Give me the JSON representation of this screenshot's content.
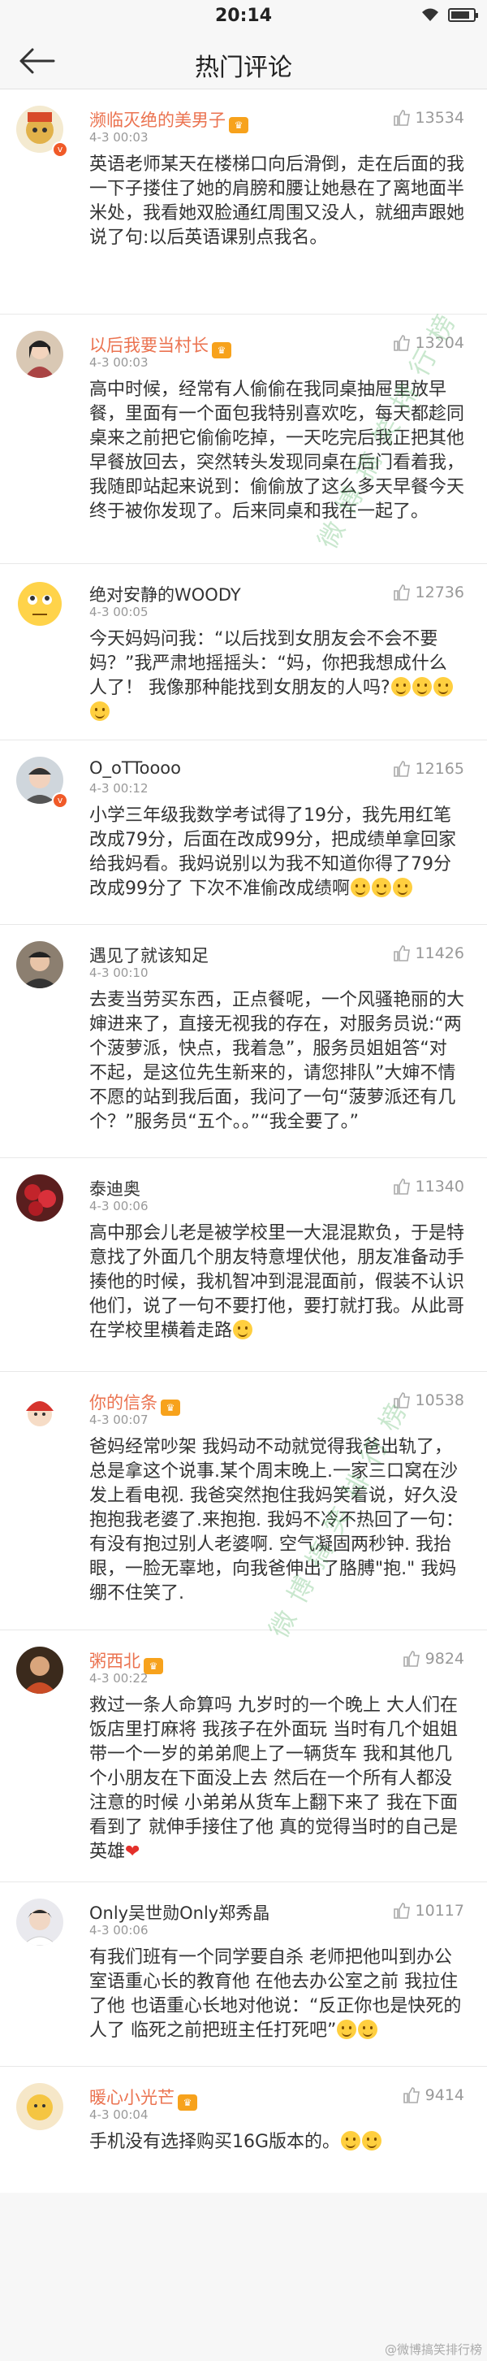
{
  "status": {
    "time": "20:14"
  },
  "header": {
    "title": "热门评论"
  },
  "watermark": "微博搞笑排行榜",
  "footer_watermark": "@微博搞笑排行榜",
  "comments": [
    {
      "name": "濒临灭绝的美男子",
      "vip": true,
      "date": "4-3 00:03",
      "likes": "13534",
      "text": "英语老师某天在楼梯口向后滑倒，走在后面的我一下子搂住了她的肩膀和腰让她悬在了离地面半米处，我看她双脸通红周围又没人，就细声跟她说了句:以后英语课别点我名。"
    },
    {
      "name": "以后我要当村长",
      "vip": true,
      "date": "4-3 00:03",
      "likes": "13204",
      "text": "高中时候，经常有人偷偷在我同桌抽屉里放早餐，里面有一个面包我特别喜欢吃，每天都趁同桌来之前把它偷偷吃掉，一天吃完后我正把其他早餐放回去，突然转头发现同桌在后门看着我，我随即站起来说到：偷偷放了这么多天早餐今天终于被你发现了。后来同桌和我在一起了。"
    },
    {
      "name": "绝对安静的WOODY",
      "vip": false,
      "date": "4-3 00:05",
      "likes": "12736",
      "text": "今天妈妈问我：“以后找到女朋友会不会不要妈？”我严肃地摇摇头：“妈，你把我想成什么人了！                    我像那种能找到女朋友的人吗?"
    },
    {
      "name": "O_oTToooo",
      "vip": false,
      "date": "4-3 00:12",
      "likes": "12165",
      "text": "小学三年级我数学考试得了19分，我先用红笔改成79分，后面在改成99分，把成绩单拿回家给我妈看。我妈说别以为我不知道你得了79分改成99分了 下次不准偷改成绩啊"
    },
    {
      "name": "遇见了就该知足",
      "vip": false,
      "date": "4-3 00:10",
      "likes": "11426",
      "text": "去麦当劳买东西，正点餐呢，一个风骚艳丽的大婶进来了，直接无视我的存在，对服务员说:“两个菠萝派，快点，我着急”，服务员姐姐答“对不起，是这位先生新来的，请您排队”大婶不情不愿的站到我后面，我问了一句“菠萝派还有几个？”服务员“五个。。”“我全要了。”"
    },
    {
      "name": "泰迪奥",
      "vip": false,
      "date": "4-3 00:06",
      "likes": "11340",
      "text": "高中那会儿老是被学校里一大混混欺负，于是特意找了外面几个朋友特意埋伏他，朋友准备动手揍他的时候，我机智冲到混混面前，假装不认识他们，说了一句不要打他，要打就打我。从此哥在学校里横着走路"
    },
    {
      "name": "你的信条",
      "vip": true,
      "date": "4-3 00:07",
      "likes": "10538",
      "text": "爸妈经常吵架 我妈动不动就觉得我爸出轨了，总是拿这个说事.某个周末晚上.一家三口窝在沙发上看电视. 我爸突然抱住我妈笑着说，好久没抱抱我老婆了.来抱抱. 我妈不冷不热回了一句：有没有抱过别人老婆啊. 空气凝固两秒钟. 我抬眼，一脸无辜地，向我爸伸出了胳膊\"抱.\" 我妈绷不住笑了."
    },
    {
      "name": "粥西北",
      "vip": true,
      "date": "4-3 00:22",
      "likes": "9824",
      "text": "救过一条人命算吗 九岁时的一个晚上 大人们在饭店里打麻将 我孩子在外面玩 当时有几个姐姐带一个一岁的弟弟爬上了一辆货车 我和其他几个小朋友在下面没上去 然后在一个所有人都没注意的时候 小弟弟从货车上翻下来了 我在下面看到了 就伸手接住了他 真的觉得当时的自己是英雄"
    },
    {
      "name": "Only吴世勋Only郑秀晶",
      "vip": false,
      "date": "4-3 00:06",
      "likes": "10117",
      "text": "有我们班有一个同学要自杀 老师把他叫到办公室语重心长的教育他 在他去办公室之前 我拉住了他 也语重心长地对他说：“反正你也是快死的人了 临死之前把班主任打死吧”"
    },
    {
      "name": "暖心小光芒",
      "vip": true,
      "date": "4-3 00:04",
      "likes": "9414",
      "text": "手机没有选择购买16G版本的。"
    }
  ]
}
